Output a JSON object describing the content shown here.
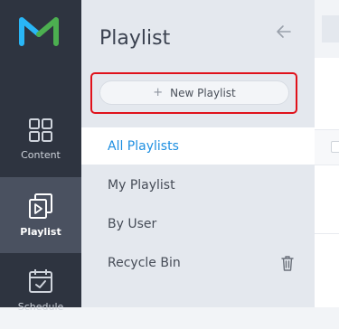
{
  "brand": {
    "logo_icon": "brand-m-logo",
    "accent": "#29b6f6",
    "accent2": "#4caf50"
  },
  "rail": {
    "items": [
      {
        "label": "Content",
        "icon": "grid-icon"
      },
      {
        "label": "Playlist",
        "icon": "playlist-icon",
        "active": true
      },
      {
        "label": "Schedule",
        "icon": "calendar-icon"
      }
    ]
  },
  "panel": {
    "title": "Playlist",
    "new_button": {
      "label": "New Playlist",
      "icon": "+"
    },
    "nav": [
      {
        "label": "All Playlists",
        "active": true
      },
      {
        "label": "My Playlist"
      },
      {
        "label": "By User"
      },
      {
        "label": "Recycle Bin"
      }
    ]
  },
  "colors": {
    "active_link": "#1e8fe1",
    "highlight": "#e0121b",
    "rail_bg": "#2e3440"
  }
}
